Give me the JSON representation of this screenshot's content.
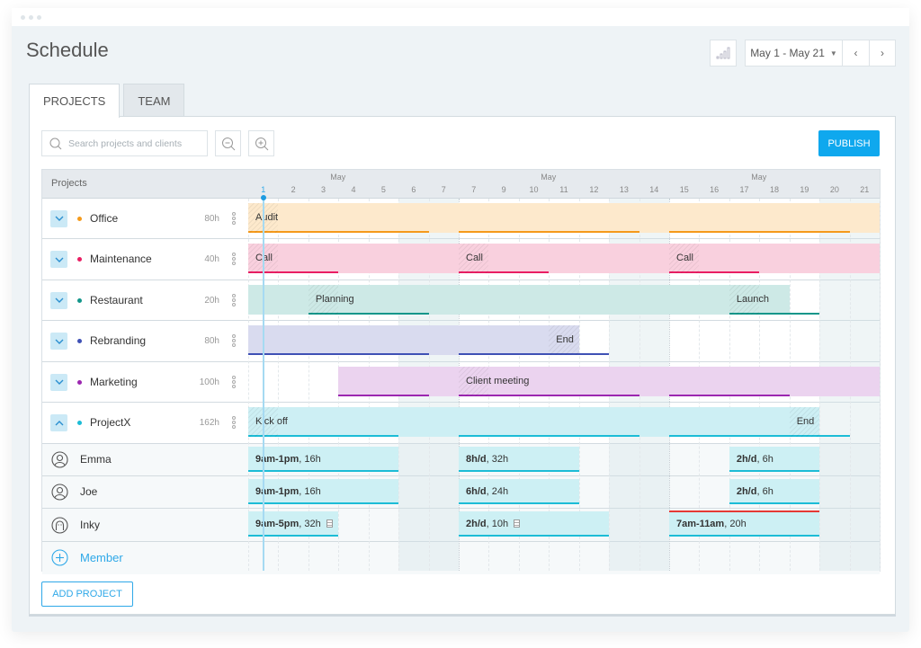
{
  "window": {
    "title": "Schedule"
  },
  "header": {
    "stats_icon": "bar-chart-icon",
    "date_range": "May 1 - May 21",
    "prev_label": "‹",
    "next_label": "›"
  },
  "tabs": [
    {
      "label": "PROJECTS",
      "active": true
    },
    {
      "label": "TEAM",
      "active": false
    }
  ],
  "toolbar": {
    "search_placeholder": "Search projects and clients",
    "zoom_out_icon": "zoom-out-icon",
    "zoom_in_icon": "zoom-in-icon",
    "publish_label": "PUBLISH"
  },
  "grid": {
    "projects_header": "Projects",
    "months": [
      "May",
      "May",
      "May"
    ],
    "days": [
      "1",
      "2",
      "3",
      "4",
      "5",
      "6",
      "7",
      "7",
      "9",
      "10",
      "11",
      "12",
      "13",
      "14",
      "15",
      "16",
      "17",
      "18",
      "19",
      "20",
      "21"
    ],
    "today_index": 0,
    "weekend_indices": [
      5,
      6,
      12,
      13,
      19,
      20
    ]
  },
  "projects": [
    {
      "name": "Office",
      "hours": "80h",
      "color": "#f59a1b",
      "fill": "#fde9cc",
      "expanded": false,
      "bar": [
        0,
        21
      ],
      "underlines": [
        [
          0,
          5
        ],
        [
          7,
          12
        ],
        [
          14,
          19
        ]
      ],
      "labels": [
        {
          "text": "Audit",
          "at": 0,
          "hatch": true
        }
      ]
    },
    {
      "name": "Maintenance",
      "hours": "40h",
      "color": "#e91e63",
      "fill": "#f9d0de",
      "expanded": false,
      "bar": [
        0,
        21
      ],
      "underlines": [
        [
          0,
          2
        ],
        [
          7,
          9
        ],
        [
          14,
          16
        ]
      ],
      "labels": [
        {
          "text": "Call",
          "at": 0,
          "hatch": true
        },
        {
          "text": "Call",
          "at": 7,
          "hatch": true
        },
        {
          "text": "Call",
          "at": 14,
          "hatch": true
        }
      ]
    },
    {
      "name": "Restaurant",
      "hours": "20h",
      "color": "#13968a",
      "fill": "#cde9e6",
      "expanded": false,
      "bar": [
        0,
        18
      ],
      "underlines": [
        [
          2,
          5
        ],
        [
          16,
          18
        ]
      ],
      "labels": [
        {
          "text": "Planning",
          "at": 2,
          "hatch": true
        },
        {
          "text": "Launch",
          "at": 16,
          "hatch": true
        }
      ]
    },
    {
      "name": "Rebranding",
      "hours": "80h",
      "color": "#3f51b5",
      "fill": "#d9dbef",
      "expanded": false,
      "bar": [
        0,
        11
      ],
      "underlines": [
        [
          0,
          5
        ],
        [
          7,
          11
        ]
      ],
      "labels": [
        {
          "text": "End",
          "at": 10,
          "hatch": true
        }
      ]
    },
    {
      "name": "Marketing",
      "hours": "100h",
      "color": "#9c27b0",
      "fill": "#ebd3ef",
      "expanded": false,
      "bar": [
        3,
        21
      ],
      "underlines": [
        [
          3,
          5
        ],
        [
          7,
          12
        ],
        [
          14,
          17
        ]
      ],
      "labels": [
        {
          "text": "Client meeting",
          "at": 7,
          "hatch": true
        }
      ]
    },
    {
      "name": "ProjectX",
      "hours": "162h",
      "color": "#1cbcd6",
      "fill": "#cdeff4",
      "expanded": true,
      "bar": [
        0,
        19
      ],
      "underlines": [
        [
          0,
          4
        ],
        [
          7,
          12
        ],
        [
          14,
          19
        ]
      ],
      "labels": [
        {
          "text": "Kick off",
          "at": 0,
          "hatch": true
        },
        {
          "text": "End",
          "at": 18,
          "hatch": true
        }
      ]
    }
  ],
  "members": [
    {
      "name": "Emma",
      "avatar": "user-avatar-icon",
      "assignments": [
        {
          "start": 0,
          "end": 5,
          "bold": "9am-1pm",
          "rest": ", 16h"
        },
        {
          "start": 7,
          "end": 11,
          "bold": "8h/d",
          "rest": ", 32h"
        },
        {
          "start": 16,
          "end": 19,
          "bold": "2h/d",
          "rest": ", 6h"
        }
      ]
    },
    {
      "name": "Joe",
      "avatar": "user-avatar-icon",
      "assignments": [
        {
          "start": 0,
          "end": 5,
          "bold": "9am-1pm",
          "rest": ", 16h"
        },
        {
          "start": 7,
          "end": 11,
          "bold": "6h/d",
          "rest": ", 24h"
        },
        {
          "start": 16,
          "end": 19,
          "bold": "2h/d",
          "rest": ", 6h"
        }
      ]
    },
    {
      "name": "Inky",
      "avatar": "ghost-avatar-icon",
      "assignments": [
        {
          "start": 0,
          "end": 3,
          "bold": "9am-5pm",
          "rest": ", 32h",
          "note": true
        },
        {
          "start": 7,
          "end": 12,
          "bold": "2h/d",
          "rest": ", 10h",
          "note": true
        },
        {
          "start": 14,
          "end": 19,
          "bold": "7am-11am",
          "rest": ", 20h",
          "overbooked": true
        }
      ]
    }
  ],
  "add_member_label": "Member",
  "add_project_label": "ADD PROJECT",
  "colors": {
    "accent": "#0fa8ee",
    "member_bar": "#cdf0f4",
    "member_line": "#1cbcd6",
    "overbooked": "#e53935"
  }
}
